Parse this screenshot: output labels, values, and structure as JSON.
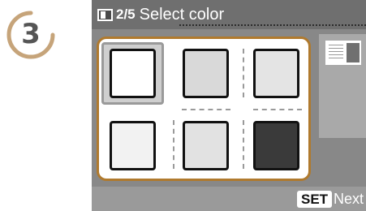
{
  "step": {
    "number": "3",
    "ring_color": "#c6a47a"
  },
  "screen": {
    "icon": "layout-icon",
    "page_indicator": "2/5",
    "title": "Select color",
    "frame_color": "#b07a2e",
    "color_options": [
      {
        "swatch": "#ffffff",
        "selected": true
      },
      {
        "swatch": "#d9d9d9",
        "selected": false
      },
      {
        "swatch": "#e4e4e4",
        "selected": false
      },
      {
        "swatch": "#f2f2f2",
        "selected": false
      },
      {
        "swatch": "#e2e2e2",
        "selected": false
      },
      {
        "swatch": "#3a3a3a",
        "selected": false
      }
    ],
    "footer": {
      "set_label": "SET",
      "next_label": "Next"
    }
  }
}
